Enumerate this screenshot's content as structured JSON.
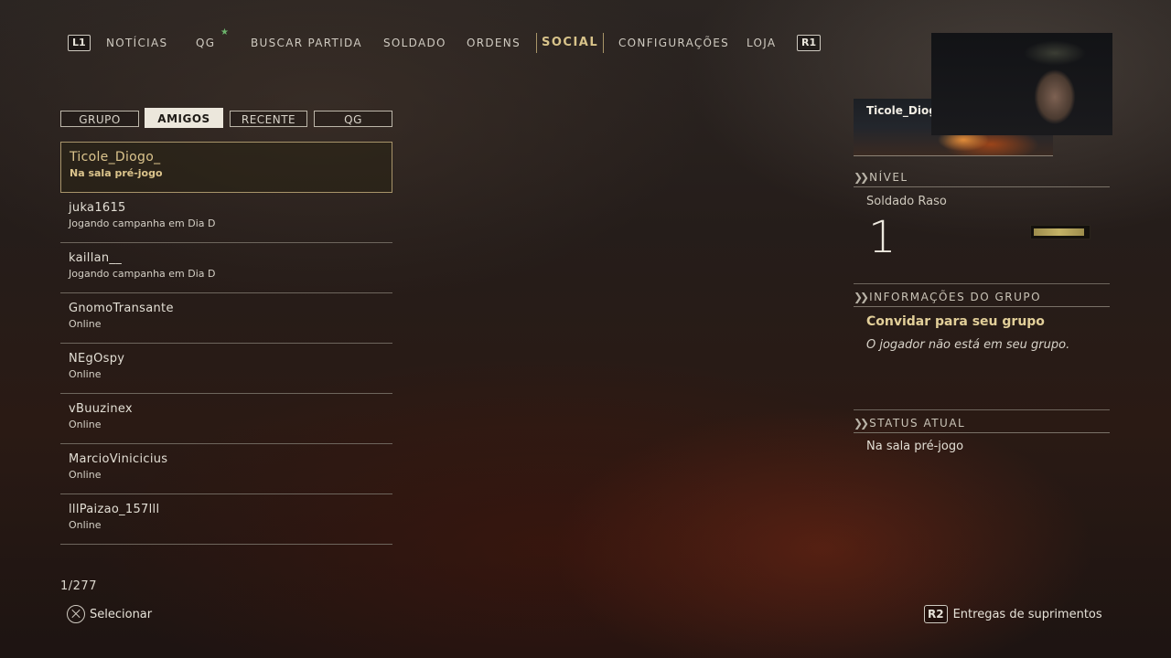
{
  "nav": {
    "left_bumper": "L1",
    "right_bumper": "R1",
    "items": [
      {
        "label": "NOTÍCIAS"
      },
      {
        "label": "QG"
      },
      {
        "label": "BUSCAR PARTIDA"
      },
      {
        "label": "SOLDADO"
      },
      {
        "label": "ORDENS"
      },
      {
        "label": "SOCIAL",
        "active": true
      },
      {
        "label": "CONFIGURAÇÕES"
      },
      {
        "label": "LOJA"
      }
    ],
    "qg_new_indicator": "★"
  },
  "tabs": [
    {
      "label": "GRUPO"
    },
    {
      "label": "AMIGOS",
      "active": true
    },
    {
      "label": "RECENTE"
    },
    {
      "label": "QG"
    }
  ],
  "friends": [
    {
      "name": "Ticole_Diogo_",
      "status": "Na sala pré-jogo",
      "selected": true
    },
    {
      "name": "juka1615",
      "status": "Jogando campanha em Dia D"
    },
    {
      "name": "kaillan__",
      "status": "Jogando campanha em Dia D"
    },
    {
      "name": "GnomoTransante",
      "status": "Online"
    },
    {
      "name": "NEgOspy",
      "status": "Online"
    },
    {
      "name": "vBuuzinex",
      "status": "Online"
    },
    {
      "name": "MarcioVinicicius",
      "status": "Online"
    },
    {
      "name": "lllPaizao_157lll",
      "status": "Online"
    }
  ],
  "list_position": "1/277",
  "hints": {
    "select_label": "Selecionar",
    "supply_button": "R2",
    "supply_label": "Entregas de suprimentos"
  },
  "profile": {
    "name": "Ticole_Diogo",
    "level_title": "NÍVEL",
    "rank_name": "Soldado Raso",
    "level": "1",
    "level_progress": 0.95,
    "group_title": "INFORMAÇÕES DO GRUPO",
    "invite_label": "Convidar para seu grupo",
    "invite_desc": "O jogador não está em seu grupo.",
    "status_title": "STATUS ATUAL",
    "status_value": "Na sala pré-jogo"
  },
  "colors": {
    "accent_gold": "#d8c38a",
    "new_indicator": "#6cb46c"
  }
}
